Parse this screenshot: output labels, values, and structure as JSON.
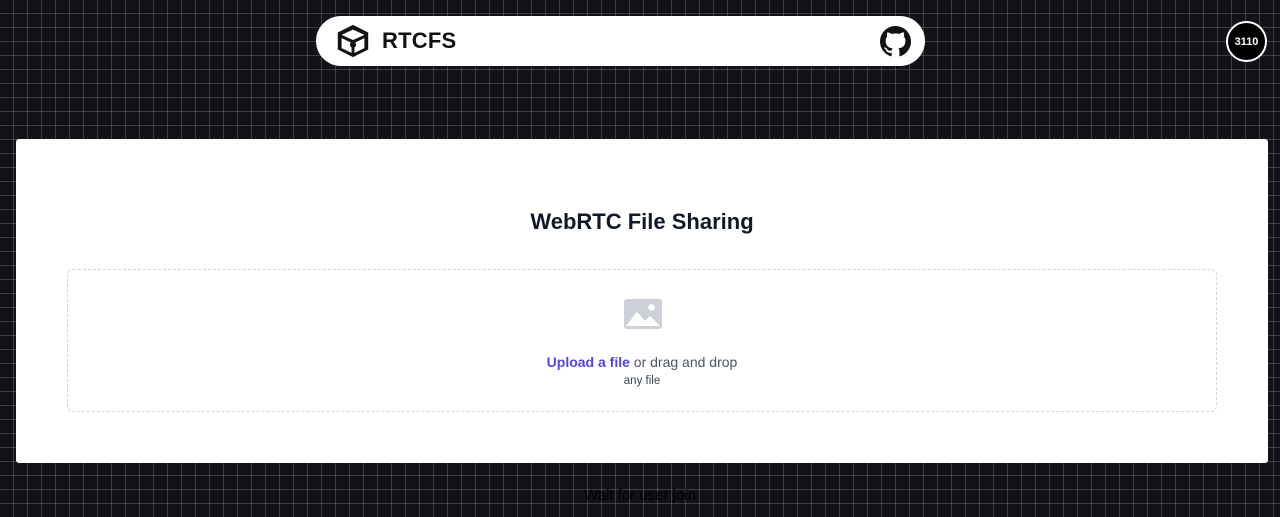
{
  "navbar": {
    "brand_name": "RTCFS",
    "brand_icon": "box-logo-icon",
    "github_icon": "github-icon"
  },
  "badge": {
    "count": "3110"
  },
  "card": {
    "title": "WebRTC File Sharing",
    "dropzone": {
      "icon": "image-icon",
      "upload_link": "Upload a file",
      "or_text": " or drag and drop",
      "hint": "any file"
    }
  },
  "status": {
    "text": "Wait for user join"
  },
  "colors": {
    "background": "#111318",
    "accent_link": "#4f46e5",
    "card": "#ffffff"
  }
}
